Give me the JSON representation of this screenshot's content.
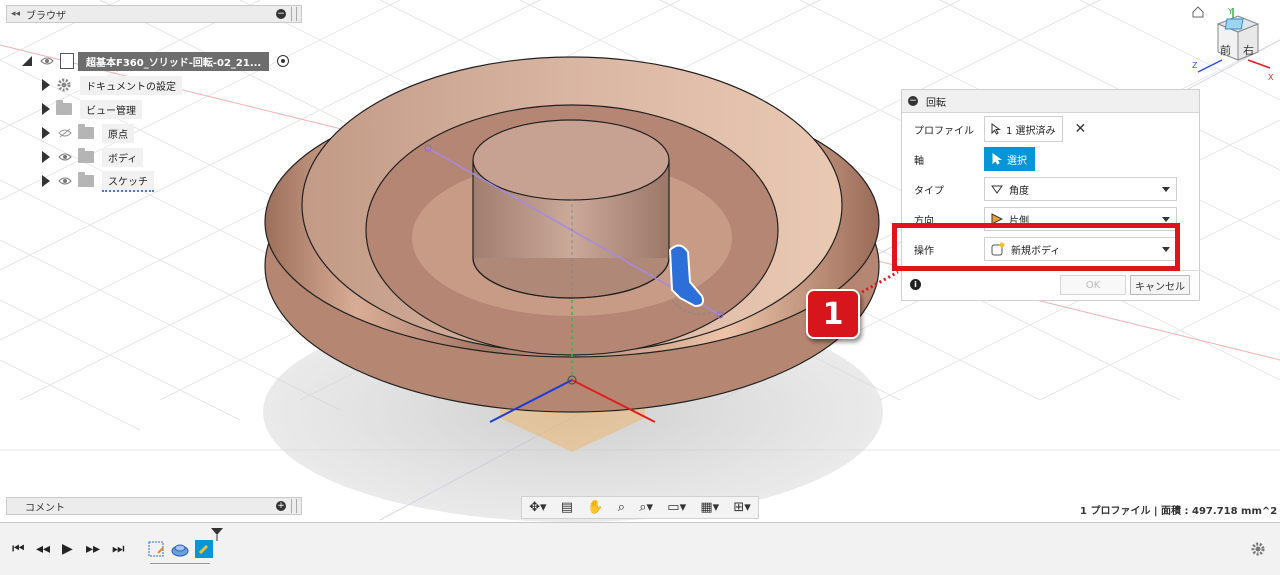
{
  "browser": {
    "title": "ブラウザ",
    "root": "超基本F360_ソリッド-回転-02_21...",
    "items": [
      {
        "label": "ドキュメントの設定"
      },
      {
        "label": "ビュー管理"
      },
      {
        "label": "原点"
      },
      {
        "label": "ボディ"
      },
      {
        "label": "スケッチ"
      }
    ]
  },
  "comment": {
    "title": "コメント"
  },
  "dialog": {
    "title": "回転",
    "profile_label": "プロファイル",
    "profile_value": "1 選択済み",
    "axis_label": "軸",
    "axis_value": "選択",
    "type_label": "タイプ",
    "type_value": "角度",
    "direction_label": "方向",
    "direction_value": "片側",
    "operation_label": "操作",
    "operation_value": "新規ボディ",
    "ok": "OK",
    "cancel": "キャンセル"
  },
  "callout": {
    "number": "1"
  },
  "status": {
    "text": "1 プロファイル | 面積 : 497.718 mm^2"
  },
  "viewcube": {
    "front": "前",
    "right": "右"
  },
  "colors": {
    "accent_blue": "#0696d7",
    "highlight_red": "#e0141c",
    "body_copper": "#c99a82"
  }
}
